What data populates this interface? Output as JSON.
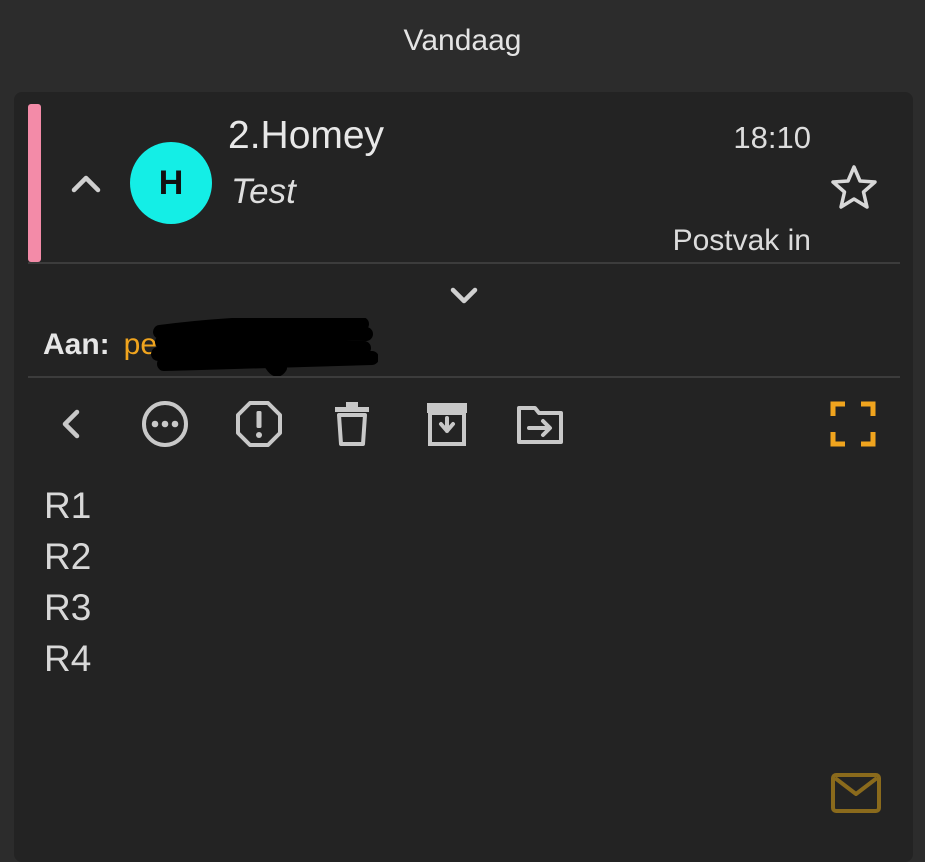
{
  "date_header": "Vandaag",
  "message": {
    "sender": "2.Homey",
    "subject": "Test",
    "avatar_letter": "H",
    "avatar_color": "#14eee6",
    "account_color": "#f38ba8",
    "time": "18:10",
    "folder": "Postvak in",
    "to_label": "Aan:",
    "to_value_visible": "pe",
    "body_lines": [
      "R1",
      "R2",
      "R3",
      "R4"
    ]
  },
  "toolbar": {
    "buttons": [
      {
        "name": "back",
        "icon": "chevron-left-icon"
      },
      {
        "name": "more",
        "icon": "more-horizontal-circle-icon"
      },
      {
        "name": "spam",
        "icon": "report-octagon-icon"
      },
      {
        "name": "delete",
        "icon": "trash-icon"
      },
      {
        "name": "archive",
        "icon": "archive-icon"
      },
      {
        "name": "move",
        "icon": "move-to-folder-icon"
      },
      {
        "name": "fullscreen",
        "icon": "fullscreen-icon"
      }
    ]
  },
  "colors": {
    "accent": "#f0a41e",
    "icon": "#c8c8c8",
    "card_bg": "#232323",
    "page_bg": "#2c2c2c"
  }
}
